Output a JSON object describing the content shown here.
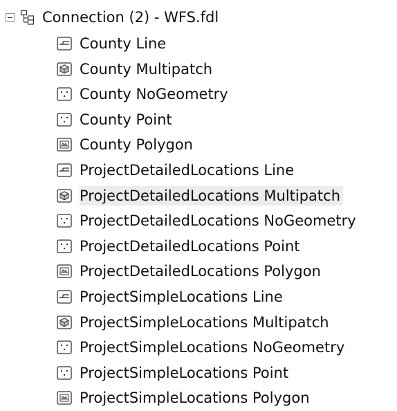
{
  "tree": {
    "root": {
      "label": "Connection (2) -  WFS.fdl",
      "expanded": true,
      "icon": "connection-icon"
    },
    "items": [
      {
        "label": "County Line",
        "icon": "line-icon"
      },
      {
        "label": "County Multipatch",
        "icon": "multipatch-icon"
      },
      {
        "label": "County NoGeometry",
        "icon": "point-icon"
      },
      {
        "label": "County Point",
        "icon": "point-icon"
      },
      {
        "label": "County Polygon",
        "icon": "polygon-icon"
      },
      {
        "label": "ProjectDetailedLocations Line",
        "icon": "line-icon"
      },
      {
        "label": "ProjectDetailedLocations Multipatch",
        "icon": "multipatch-icon",
        "selected": true
      },
      {
        "label": "ProjectDetailedLocations NoGeometry",
        "icon": "point-icon"
      },
      {
        "label": "ProjectDetailedLocations Point",
        "icon": "point-icon"
      },
      {
        "label": "ProjectDetailedLocations Polygon",
        "icon": "polygon-icon"
      },
      {
        "label": "ProjectSimpleLocations Line",
        "icon": "line-icon"
      },
      {
        "label": "ProjectSimpleLocations Multipatch",
        "icon": "multipatch-icon"
      },
      {
        "label": "ProjectSimpleLocations NoGeometry",
        "icon": "point-icon"
      },
      {
        "label": "ProjectSimpleLocations Point",
        "icon": "point-icon"
      },
      {
        "label": "ProjectSimpleLocations Polygon",
        "icon": "polygon-icon"
      }
    ]
  },
  "colors": {
    "selected_background": "#ececec",
    "icon_border": "#333333",
    "text": "#111111"
  }
}
